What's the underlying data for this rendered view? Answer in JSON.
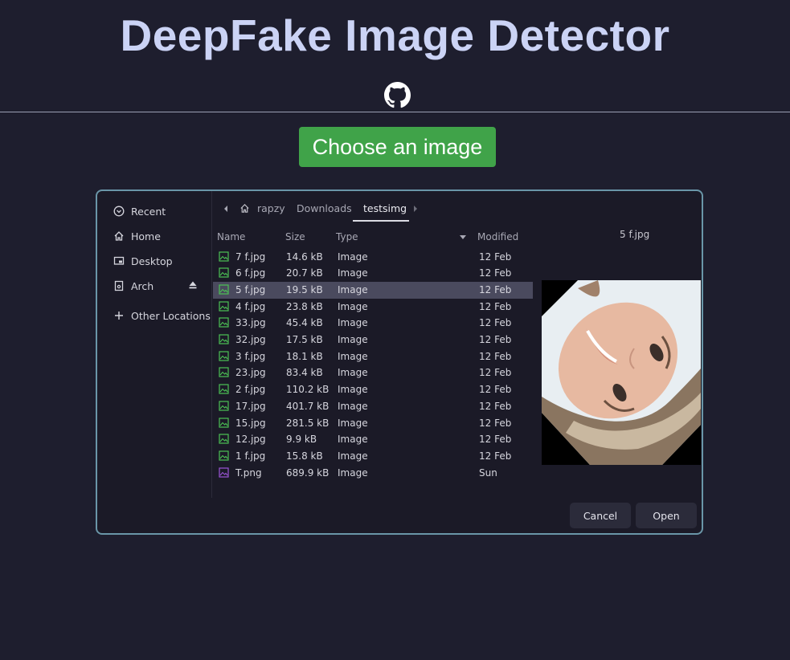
{
  "page": {
    "title": "DeepFake Image Detector",
    "choose_button": "Choose an image"
  },
  "dialog": {
    "sidebar": {
      "recent": "Recent",
      "home": "Home",
      "desktop": "Desktop",
      "arch": "Arch",
      "other": "Other Locations"
    },
    "path": {
      "user": "rapzy",
      "downloads": "Downloads",
      "current": "testsimg"
    },
    "columns": {
      "name": "Name",
      "size": "Size",
      "type": "Type",
      "modified": "Modified"
    },
    "files": [
      {
        "name": "7 f.jpg",
        "size": "14.6 kB",
        "type": "Image",
        "modified": "12 Feb"
      },
      {
        "name": "6 f.jpg",
        "size": "20.7 kB",
        "type": "Image",
        "modified": "12 Feb"
      },
      {
        "name": "5 f.jpg",
        "size": "19.5 kB",
        "type": "Image",
        "modified": "12 Feb"
      },
      {
        "name": "4 f.jpg",
        "size": "23.8 kB",
        "type": "Image",
        "modified": "12 Feb"
      },
      {
        "name": "33.jpg",
        "size": "45.4 kB",
        "type": "Image",
        "modified": "12 Feb"
      },
      {
        "name": "32.jpg",
        "size": "17.5 kB",
        "type": "Image",
        "modified": "12 Feb"
      },
      {
        "name": "3 f.jpg",
        "size": "18.1 kB",
        "type": "Image",
        "modified": "12 Feb"
      },
      {
        "name": "23.jpg",
        "size": "83.4 kB",
        "type": "Image",
        "modified": "12 Feb"
      },
      {
        "name": "2 f.jpg",
        "size": "110.2 kB",
        "type": "Image",
        "modified": "12 Feb"
      },
      {
        "name": "17.jpg",
        "size": "401.7 kB",
        "type": "Image",
        "modified": "12 Feb"
      },
      {
        "name": "15.jpg",
        "size": "281.5 kB",
        "type": "Image",
        "modified": "12 Feb"
      },
      {
        "name": "12.jpg",
        "size": "9.9 kB",
        "type": "Image",
        "modified": "12 Feb"
      },
      {
        "name": "1 f.jpg",
        "size": "15.8 kB",
        "type": "Image",
        "modified": "12 Feb"
      },
      {
        "name": "T.png",
        "size": "689.9 kB",
        "type": "Image",
        "modified": "Sun"
      }
    ],
    "selected_index": 2,
    "preview_name": "5 f.jpg",
    "cancel": "Cancel",
    "open": "Open"
  },
  "colors": {
    "background": "#1e1e2e",
    "title": "#cbd3f5",
    "button_green": "#40a349",
    "dialog_border": "#6a96a8",
    "jpg_icon": "#4cc255",
    "png_icon": "#9b55d6"
  },
  "icons": [
    "github-icon",
    "clock-icon",
    "home-icon",
    "desktop-icon",
    "drive-icon",
    "eject-icon",
    "plus-icon",
    "chevron-left-icon",
    "chevron-right-icon",
    "sort-down-icon",
    "image-file-icon"
  ]
}
